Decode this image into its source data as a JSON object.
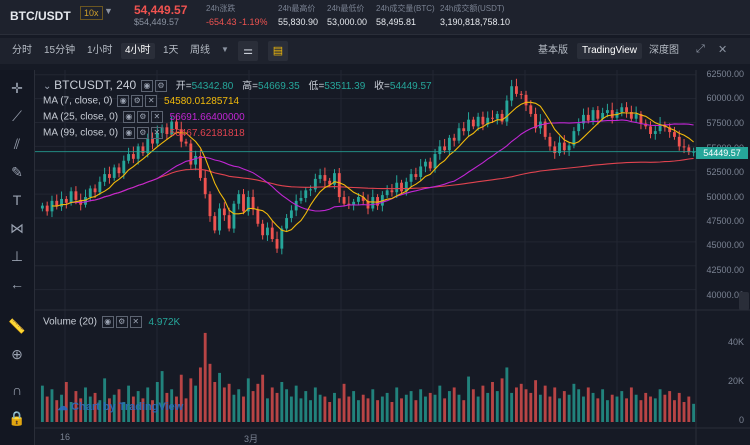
{
  "header": {
    "pair": "BTC/USDT",
    "leverage": "10x",
    "last_price": "54,449.57",
    "last_price_usd": "$54,449.57",
    "stats": [
      {
        "label": "24h涨跌",
        "value": "-654.43 -1.19%",
        "negative": true
      },
      {
        "label": "24h最高价",
        "value": "55,830.90",
        "negative": false
      },
      {
        "label": "24h最低价",
        "value": "53,000.00",
        "negative": false
      },
      {
        "label": "24h成交量(BTC)",
        "value": "58,495.81",
        "negative": false
      },
      {
        "label": "24h成交额(USDT)",
        "value": "3,190,818,758.10",
        "negative": false
      }
    ]
  },
  "toolbar": {
    "timeframes": [
      "分时",
      "15分钟",
      "1小时",
      "4小时",
      "1天",
      "周线"
    ],
    "active_timeframe": "4小时",
    "views": [
      "基本版",
      "TradingView",
      "深度图"
    ],
    "active_view": "TradingView"
  },
  "legend": {
    "symbol": "BTCUSDT, 240",
    "open_label": "开=",
    "open": "54342.80",
    "high_label": "高=",
    "high": "54669.35",
    "low_label": "低=",
    "low": "53511.39",
    "close_label": "收=",
    "close": "54449.57",
    "ma7_label": "MA (7, close, 0)",
    "ma7_value": "54580.01285714",
    "ma25_label": "MA (25, close, 0)",
    "ma25_value": "56691.66400000",
    "ma99_label": "MA (99, close, 0)",
    "ma99_value": "56467.62181818",
    "volume_label": "Volume (20)",
    "volume_value": "4.972K"
  },
  "colors": {
    "up": "#26a69a",
    "down": "#ef5350",
    "ma7": "#f0b90b",
    "ma25": "#c026d3",
    "ma99": "#e0434f",
    "background": "#161a25"
  },
  "price_axis": [
    "62500.00",
    "60000.00",
    "57500.00",
    "55000.00",
    "52500.00",
    "50000.00",
    "47500.00",
    "45000.00",
    "42500.00",
    "40000.00"
  ],
  "current_price_tag": "54449.57",
  "volume_axis": [
    "40K",
    "20K",
    "0"
  ],
  "date_axis": [
    "16",
    "3月"
  ],
  "watermark": "Chart by TradingView",
  "chart_data": {
    "type": "candlestick",
    "interval": "4h",
    "ylim": [
      38500,
      63000
    ],
    "closes": [
      48800,
      48200,
      49300,
      48700,
      49500,
      49100,
      50300,
      49400,
      48900,
      49700,
      50600,
      50200,
      51300,
      52100,
      51700,
      52800,
      52200,
      53500,
      54200,
      53700,
      55000,
      54300,
      55800,
      55300,
      56400,
      57000,
      56300,
      57600,
      56800,
      55500,
      55300,
      53100,
      54000,
      51700,
      50000,
      47700,
      46200,
      48500,
      47800,
      46400,
      49000,
      50000,
      48200,
      49700,
      48400,
      46900,
      45700,
      46500,
      45300,
      44300,
      46400,
      47500,
      48300,
      49300,
      49600,
      50400,
      50500,
      51600,
      52000,
      51400,
      51000,
      52200,
      49700,
      49000,
      48900,
      49200,
      49700,
      49300,
      48500,
      49700,
      48800,
      49900,
      50400,
      50200,
      51200,
      50300,
      51300,
      52100,
      51800,
      52900,
      53400,
      52700,
      54200,
      55000,
      54600,
      55900,
      55600,
      56900,
      56600,
      57800,
      57100,
      58100,
      57300,
      58000,
      57900,
      58400,
      57600,
      59800,
      61300,
      60500,
      60400,
      59300,
      58400,
      56900,
      57600,
      56000,
      55000,
      54300,
      55400,
      54600,
      55100,
      56600,
      57400,
      58300,
      57700,
      58800,
      57900,
      58500,
      58800,
      58000,
      58600,
      59100,
      58600,
      57900,
      58400,
      57400,
      57100,
      56300,
      56600,
      57300,
      57000,
      56500,
      56000,
      55000,
      54900,
      54400,
      54449.57
    ],
    "volumes": [
      20,
      14,
      18,
      12,
      15,
      22,
      11,
      17,
      13,
      19,
      14,
      16,
      12,
      24,
      13,
      15,
      18,
      11,
      20,
      14,
      17,
      13,
      19,
      12,
      22,
      28,
      16,
      18,
      14,
      26,
      13,
      24,
      20,
      30,
      49,
      32,
      22,
      27,
      19,
      21,
      15,
      18,
      14,
      24,
      17,
      21,
      26,
      13,
      19,
      16,
      22,
      18,
      14,
      20,
      13,
      17,
      12,
      19,
      15,
      14,
      11,
      16,
      13,
      21,
      14,
      17,
      12,
      15,
      13,
      18,
      12,
      14,
      16,
      11,
      19,
      13,
      15,
      17,
      12,
      18,
      14,
      16,
      15,
      20,
      13,
      17,
      19,
      15,
      12,
      25,
      18,
      14,
      20,
      16,
      22,
      17,
      24,
      30,
      16,
      19,
      21,
      18,
      16,
      23,
      15,
      20,
      14,
      19,
      13,
      17,
      15,
      21,
      18,
      14,
      19,
      16,
      13,
      18,
      12,
      15,
      14,
      17,
      13,
      19,
      15,
      12,
      16,
      14,
      13,
      18,
      15,
      17,
      12,
      16,
      11,
      14,
      10
    ],
    "volume_ylim": [
      0,
      55
    ],
    "volume_unit": "K"
  }
}
